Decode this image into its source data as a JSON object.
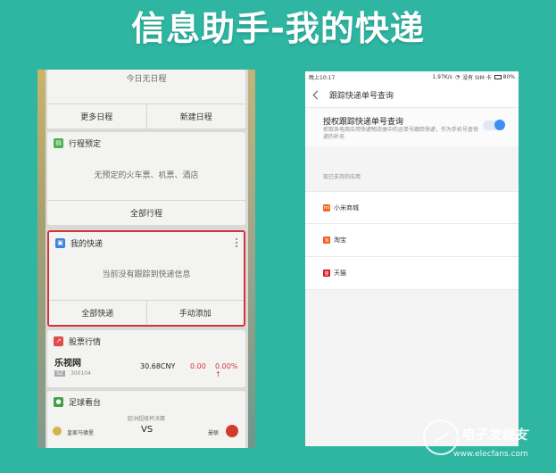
{
  "banner": {
    "title": "信息助手-我的快递"
  },
  "left_phone": {
    "schedule_card": {
      "empty_text": "今日无日程",
      "more_button": "更多日程",
      "new_button": "新建日程"
    },
    "booking_card": {
      "title": "行程预定",
      "empty_text": "无预定的火车票、机票、酒店",
      "all_button": "全部行程"
    },
    "express_card": {
      "title": "我的快递",
      "empty_text": "当前没有跟踪到快递信息",
      "all_button": "全部快递",
      "add_button": "手动添加"
    },
    "stock_card": {
      "title": "股票行情",
      "stock_name": "乐视网",
      "market_tag": "SZ",
      "stock_code": "300104",
      "price": "30.68CNY",
      "change": "0.00",
      "percent": "0.00%",
      "arrow": "↑"
    },
    "football_card": {
      "title": "足球看台",
      "match_name": "欧洲超级杯决赛",
      "home_team": "皇家马德里",
      "vs": "VS",
      "away_team": "曼联"
    }
  },
  "right_phone": {
    "status_bar": {
      "time": "晚上10:17",
      "speed": "1.97K/s",
      "carrier": "没有 SIM 卡",
      "battery": "80%"
    },
    "nav": {
      "title": "跟踪快递单号查询"
    },
    "setting": {
      "title": "授权跟踪快递单号查询",
      "description": "抓取各电商应用快递物流类中的运单号跟踪快递，作为手机号查快递的补充"
    },
    "supported_label": "现已支持的应用",
    "apps": [
      {
        "label": "小米商城",
        "icon_text": "mi",
        "color": "#f26b1d"
      },
      {
        "label": "淘宝",
        "icon_text": "淘",
        "color": "#f25a1d"
      },
      {
        "label": "天猫",
        "icon_text": "猫",
        "color": "#d7141d"
      }
    ]
  },
  "watermark": {
    "chinese": "电子发烧友",
    "url": "www.elecfans.com"
  }
}
